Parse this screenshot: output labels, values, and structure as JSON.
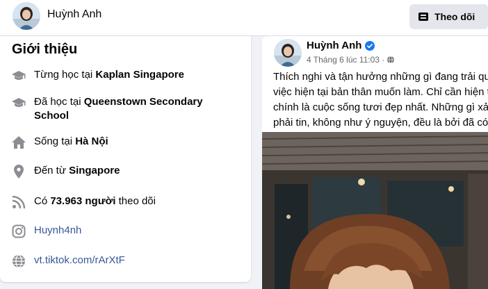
{
  "header": {
    "name": "Huỳnh Anh",
    "follow_label": "Theo dõi",
    "follow_icon": "follow-icon"
  },
  "intro": {
    "title": "Giới thiệu",
    "items": [
      {
        "icon": "graduation-cap-icon",
        "prefix": "Từng học tại ",
        "bold": "Kaplan Singapore",
        "suffix": ""
      },
      {
        "icon": "graduation-cap-icon",
        "prefix": "Đã học tại ",
        "bold": "Queenstown Secondary School",
        "suffix": ""
      },
      {
        "icon": "home-icon",
        "prefix": "Sống tại ",
        "bold": "Hà Nội",
        "suffix": ""
      },
      {
        "icon": "location-pin-icon",
        "prefix": "Đến từ ",
        "bold": "Singapore",
        "suffix": ""
      },
      {
        "icon": "rss-icon",
        "prefix": "Có ",
        "bold": "73.963 người",
        "suffix": " theo dõi"
      },
      {
        "icon": "instagram-icon",
        "link": "Huynh4nh"
      },
      {
        "icon": "globe-icon",
        "link": "vt.tiktok.com/rArXtF"
      }
    ]
  },
  "post": {
    "author": "Huỳnh Anh",
    "verified": true,
    "timestamp": "4 Tháng 6 lúc 11:03 · ",
    "privacy_icon": "globe-icon",
    "lines": [
      "Thích nghi và tận hưởng những gì đang trải qu",
      "việc hiện tại bản thân muốn làm. Chỉ cần hiện t",
      "chính là cuộc sống tươi đẹp nhất. Những gì xả",
      "phải tin, không như ý nguyện, đều là bởi đã có"
    ]
  },
  "colors": {
    "accent": "#1877f2",
    "link": "#385898",
    "muted": "#65676b",
    "icon": "#65676b"
  }
}
